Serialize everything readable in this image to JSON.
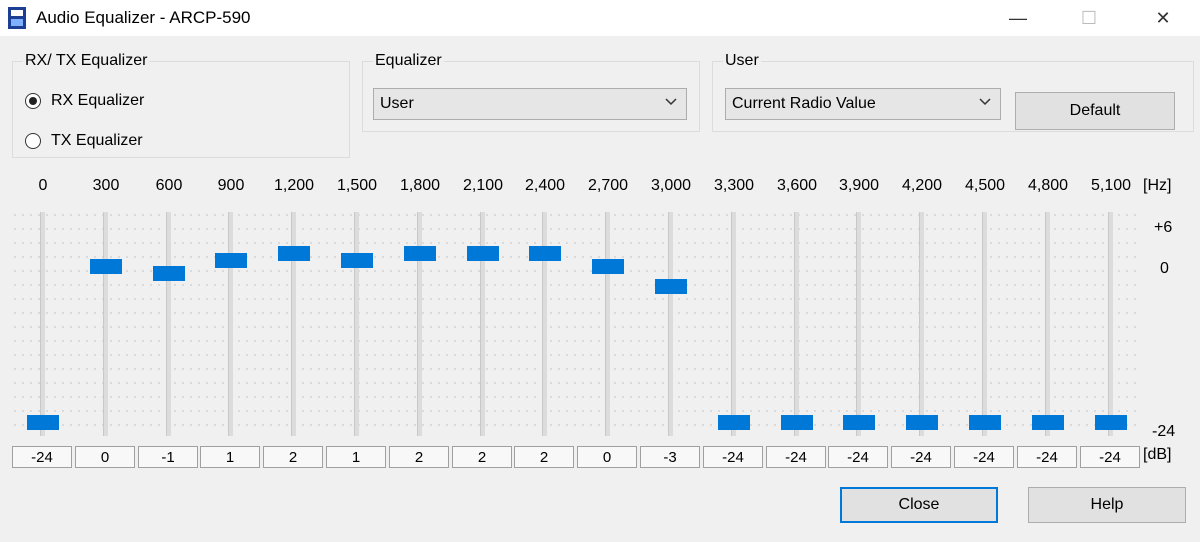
{
  "window": {
    "title": "Audio Equalizer - ARCP-590",
    "min_glyph": "—",
    "max_glyph": "☐",
    "close_glyph": "✕"
  },
  "rxtx": {
    "legend": "RX/ TX Equalizer",
    "rx_label": "RX Equalizer",
    "tx_label": "TX Equalizer",
    "selected": "rx"
  },
  "equalizer": {
    "legend": "Equalizer",
    "value": "User"
  },
  "user": {
    "legend": "User",
    "value": "Current Radio Value",
    "default_label": "Default"
  },
  "bands": [
    {
      "freq": "0",
      "value": "-24"
    },
    {
      "freq": "300",
      "value": "0"
    },
    {
      "freq": "600",
      "value": "-1"
    },
    {
      "freq": "900",
      "value": "1"
    },
    {
      "freq": "1,200",
      "value": "2"
    },
    {
      "freq": "1,500",
      "value": "1"
    },
    {
      "freq": "1,800",
      "value": "2"
    },
    {
      "freq": "2,100",
      "value": "2"
    },
    {
      "freq": "2,400",
      "value": "2"
    },
    {
      "freq": "2,700",
      "value": "0"
    },
    {
      "freq": "3,000",
      "value": "-3"
    },
    {
      "freq": "3,300",
      "value": "-24"
    },
    {
      "freq": "3,600",
      "value": "-24"
    },
    {
      "freq": "3,900",
      "value": "-24"
    },
    {
      "freq": "4,200",
      "value": "-24"
    },
    {
      "freq": "4,500",
      "value": "-24"
    },
    {
      "freq": "4,800",
      "value": "-24"
    },
    {
      "freq": "5,100",
      "value": "-24"
    }
  ],
  "scale": {
    "hz_unit": "[Hz]",
    "db_unit": "[dB]",
    "top": "+6",
    "mid": "0",
    "bottom": "-24",
    "max": 6,
    "min": -24
  },
  "buttons": {
    "close_label": "Close",
    "help_label": "Help"
  },
  "colors": {
    "accent": "#0078d7"
  }
}
